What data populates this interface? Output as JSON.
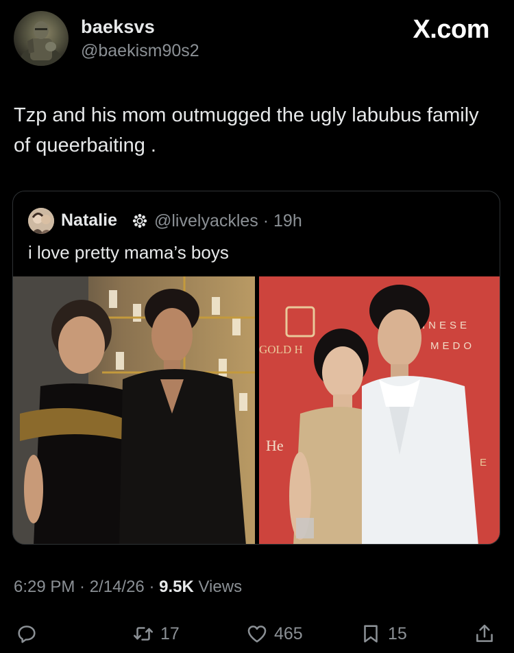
{
  "author": {
    "display_name": "baeksvs",
    "handle": "@baekism90s2",
    "avatar_icon": "knight-avatar"
  },
  "site": {
    "logo": "X.com"
  },
  "tweet": {
    "text": "Tzp and his mom outmugged the ugly labubus family of queerbaiting ."
  },
  "quote": {
    "display_name": "Natalie",
    "badge_icon": "verified-badge-icon",
    "handle_time": "@livelyackles · 19h",
    "text": "i love pretty mama’s boys",
    "photos": [
      {
        "name": "photo-left",
        "description_icon": "mother-son-gold-backdrop"
      },
      {
        "name": "photo-right",
        "description_icon": "mother-son-red-backdrop",
        "backdrop_text": [
          "INESE",
          "MEDO",
          "GOLD H",
          "He",
          "E"
        ]
      }
    ]
  },
  "meta": {
    "time_date": "6:29 PM · 2/14/26 · ",
    "views_count": "9.5K",
    "views_label": " Views"
  },
  "actions": {
    "reply_count": "",
    "retweet_count": "17",
    "like_count": "465",
    "bookmark_count": "15",
    "share_count": ""
  },
  "colors": {
    "background": "#000000",
    "text_primary": "#e7e9ea",
    "text_secondary": "#8b9095",
    "border": "#2f3336"
  }
}
